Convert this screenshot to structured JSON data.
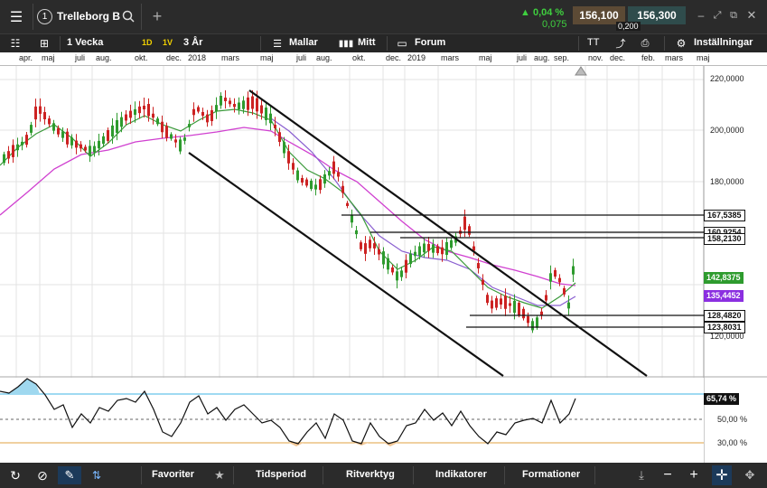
{
  "topbar": {
    "instrument_number": "1",
    "instrument_name": "Trelleborg B",
    "change_pct": "0,04 %",
    "change_abs": "0,075",
    "bid": "156,100",
    "ask": "156,300",
    "spread": "0,200"
  },
  "toolbar": {
    "interval": "1 Vecka",
    "range_1d": "1D",
    "range_1y": "1V",
    "range_3y": "3 År",
    "templates": "Mallar",
    "mine": "Mitt",
    "forum": "Forum",
    "text_size": "TT",
    "settings": "Inställningar"
  },
  "dates": [
    "apr.",
    "maj",
    "juli",
    "aug.",
    "okt.",
    "dec.",
    "2018",
    "mars",
    "maj",
    "juli",
    "aug.",
    "okt.",
    "dec.",
    "2019",
    "mars",
    "maj",
    "juli",
    "aug.",
    "sep.",
    "nov.",
    "dec.",
    "feb.",
    "mars",
    "maj"
  ],
  "price_axis": [
    "220,0000",
    "200,0000",
    "180,0000",
    "120,0000"
  ],
  "levels": {
    "l1": "167,5385",
    "l2": "160,9254",
    "l3": "158,2130",
    "last": "142,8375",
    "ma": "135,4452",
    "l4": "128,4820",
    "l5": "123,8031"
  },
  "oscillator": {
    "value": "65,74 %",
    "axis": [
      "50,00 %",
      "30,00 %"
    ]
  },
  "bottombar": {
    "favorites": "Favoriter",
    "period": "Tidsperiod",
    "drawing": "Ritverktyg",
    "indicators": "Indikatorer",
    "formations": "Formationer"
  },
  "colors": {
    "up": "#2e9b2e",
    "down": "#cc2222",
    "ma_fast": "#3a9a3a",
    "ma_slow": "#d040d0",
    "ma_mid": "#8a5fd0",
    "last_tag": "#2e9b2e",
    "ma_tag": "#8b2fe0"
  }
}
